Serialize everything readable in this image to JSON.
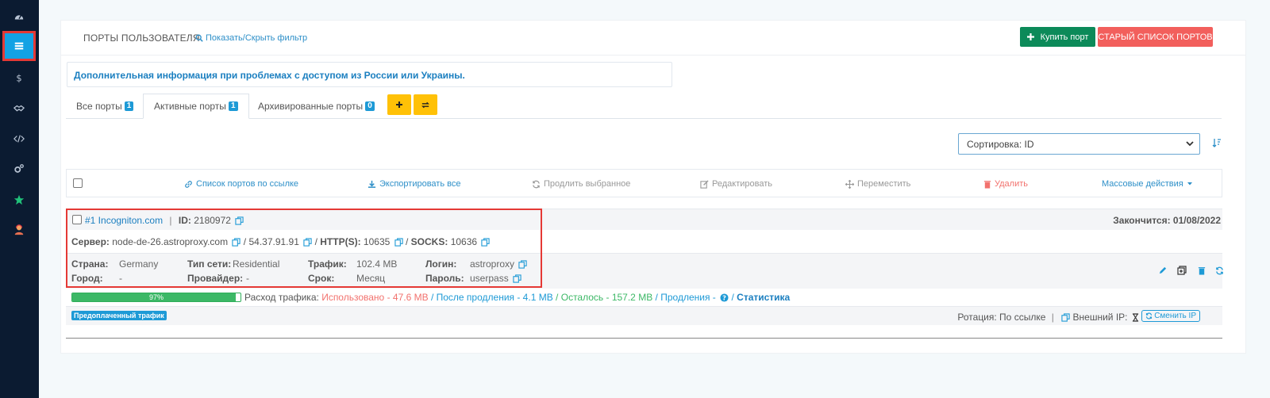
{
  "header": {
    "title": "ПОРТЫ ПОЛЬЗОВАТЕЛЯ",
    "filter_link": "Показать/Скрыть фильтр",
    "buy_button": "Купить порт",
    "old_list_button": "СТАРЫЙ СПИСОК ПОРТОВ"
  },
  "info": {
    "text": "Дополнительная информация при проблемах с доступом из России или Украины."
  },
  "tabs": [
    {
      "label": "Все порты",
      "count": "1"
    },
    {
      "label": "Активные порты",
      "count": "1"
    },
    {
      "label": "Архивированные порты",
      "count": "0"
    }
  ],
  "sort": {
    "value": "Сортировка: ID"
  },
  "toolbar": {
    "link_list": "Список портов по ссылке",
    "export_all": "Экспортировать все",
    "renew_selected": "Продлить выбранное",
    "edit": "Редактировать",
    "move": "Переместить",
    "delete": "Удалить",
    "bulk": "Массовые действия"
  },
  "port": {
    "title": "#1 Incogniton.com",
    "id_label": "ID:",
    "id_value": "2180972",
    "expires": "Закончится: 01/08/2022",
    "server_label": "Сервер:",
    "server_value": "node-de-26.astroproxy.com",
    "ip": "54.37.91.91",
    "http_label": "HTTP(S):",
    "http_port": "10635",
    "socks_label": "SOCKS:",
    "socks_port": "10636",
    "country_label": "Страна:",
    "country": "Germany",
    "city_label": "Город:",
    "city": "-",
    "net_type_label": "Тип сети:",
    "net_type": "Residential",
    "provider_label": "Провайдер:",
    "provider": "-",
    "traffic_label": "Трафик:",
    "traffic": "102.4 MB",
    "term_label": "Срок:",
    "term": "Месяц",
    "login_label": "Логин:",
    "login": "astroproxy",
    "password_label": "Пароль:",
    "password": "userpass",
    "progress_label": "97%",
    "progress_fraction": 0.97,
    "usage_label": "Расход трафика:",
    "used": "Использовано - 47.6 MB",
    "after_renew": "После продления - 4.1 MB",
    "remaining": "Осталось - 157.2 MB",
    "renewals": "Продления -",
    "stats": "Статистика",
    "prepaid_tag": "Предоплаченный трафик",
    "rotation": "Ротация: По ссылке",
    "external_ip": "Внешний IP:",
    "change_ip": "Сменить IP"
  },
  "colors": {
    "sidebar": "#0b1b31",
    "accent": "#13a2e4",
    "buy": "#0c8a59",
    "old": "#f25f5c",
    "warn": "#ffc107",
    "green": "#3cb866",
    "red": "#f2726e"
  }
}
